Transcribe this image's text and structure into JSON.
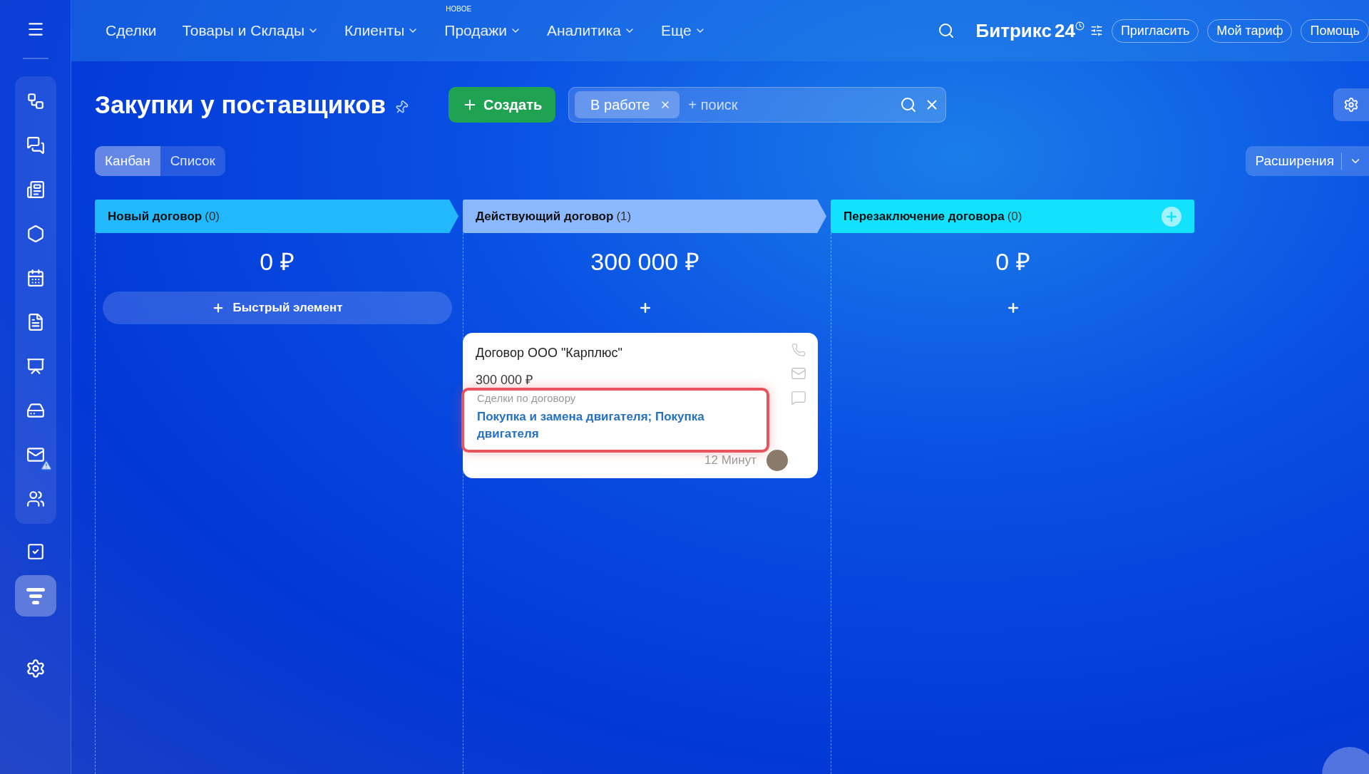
{
  "top_nav": {
    "items": [
      {
        "label": "Сделки",
        "has_menu": false
      },
      {
        "label": "Товары и Склады",
        "has_menu": true
      },
      {
        "label": "Клиенты",
        "has_menu": true
      },
      {
        "label": "Продажи",
        "has_menu": true,
        "badge": "НОВОЕ"
      },
      {
        "label": "Аналитика",
        "has_menu": true
      },
      {
        "label": "Еще",
        "has_menu": true
      }
    ],
    "logo": {
      "name": "Битрикс",
      "suffix": "24"
    },
    "buttons": [
      "Пригласить",
      "Мой тариф",
      "Помощь"
    ]
  },
  "sidebar": {
    "items": [
      {
        "kind": "grouped",
        "selected": false,
        "warning": false
      },
      {
        "kind": "grouped",
        "selected": false,
        "warning": false
      },
      {
        "kind": "grouped",
        "selected": false,
        "warning": false
      },
      {
        "kind": "grouped",
        "selected": false,
        "warning": false
      },
      {
        "kind": "grouped",
        "selected": false,
        "warning": false
      },
      {
        "kind": "grouped",
        "selected": false,
        "warning": false
      },
      {
        "kind": "grouped",
        "selected": false,
        "warning": false
      },
      {
        "kind": "grouped",
        "selected": false,
        "warning": false
      },
      {
        "kind": "grouped",
        "selected": false,
        "warning": true
      },
      {
        "kind": "grouped",
        "selected": false,
        "warning": false
      },
      {
        "kind": "single",
        "selected": false,
        "warning": false
      },
      {
        "kind": "single",
        "selected": true,
        "warning": false
      }
    ]
  },
  "page": {
    "title": "Закупки у поставщиков",
    "create_button": "Создать",
    "filter": {
      "tag": "В работе",
      "placeholder": "+ поиск"
    },
    "views": [
      {
        "label": "Канбан",
        "selected": true
      },
      {
        "label": "Список",
        "selected": false
      }
    ],
    "extensions_button": "Расширения"
  },
  "columns": [
    {
      "name": "Новый договор",
      "count": "(0)",
      "color": "#22b8fe",
      "sum": "0 ₽",
      "kind": "quick",
      "add_label": "Быстрый элемент"
    },
    {
      "name": "Действующий договор",
      "count": "(1)",
      "color": "#8cb8ff",
      "sum": "300 000 ₽",
      "kind": "plus",
      "cards": [
        {
          "title": "Договор ООО \"Карплюс\"",
          "amount": "300 000 ₽",
          "field_label": "Сделки по договору",
          "field_value": "Покупка и замена двигателя; Покупка двигателя",
          "time": "12 Минут",
          "highlighted": true
        }
      ]
    },
    {
      "name": "Перезаключение договора",
      "count": "(0)",
      "color": "#12e2fe",
      "sum": "0 ₽",
      "kind": "plus"
    }
  ]
}
